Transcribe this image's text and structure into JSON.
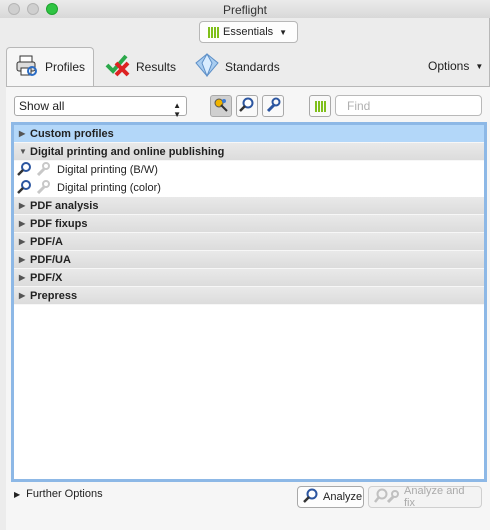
{
  "window": {
    "title": "Preflight"
  },
  "toolbar": {
    "workspace_label": "Essentials"
  },
  "tabs": [
    {
      "label": "Profiles",
      "icon": "printer-icon"
    },
    {
      "label": "Results",
      "icon": "check-cross-icon"
    },
    {
      "label": "Standards",
      "icon": "diamond-icon"
    }
  ],
  "options": {
    "label": "Options"
  },
  "filter": {
    "selected": "Show all"
  },
  "search": {
    "placeholder": "Find"
  },
  "tree": {
    "groups": [
      {
        "label": "Custom profiles",
        "selected": true,
        "expanded": false
      },
      {
        "label": "Digital printing and online publishing",
        "expanded": true,
        "children": [
          {
            "label": "Digital printing (B/W)"
          },
          {
            "label": "Digital printing (color)"
          }
        ]
      },
      {
        "label": "PDF analysis",
        "expanded": false
      },
      {
        "label": "PDF fixups",
        "expanded": false
      },
      {
        "label": "PDF/A",
        "expanded": false
      },
      {
        "label": "PDF/UA",
        "expanded": false
      },
      {
        "label": "PDF/X",
        "expanded": false
      },
      {
        "label": "Prepress",
        "expanded": false
      }
    ]
  },
  "footer": {
    "further_options": "Further Options",
    "analyze": "Analyze",
    "analyze_fix": "Analyze and fix"
  },
  "colors": {
    "selection": "#b3d7f9",
    "focus_ring": "#8db8e6",
    "bar_green": "#7fbf1a"
  }
}
